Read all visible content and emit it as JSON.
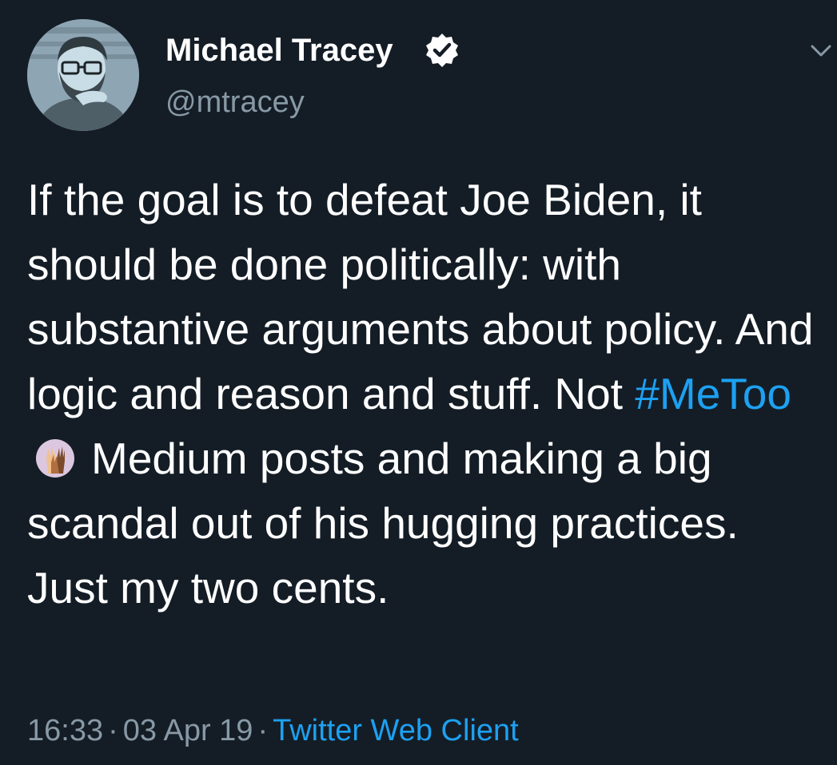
{
  "author": {
    "display_name": "Michael Tracey",
    "handle": "@mtracey",
    "verified_icon": "verified-badge-icon",
    "avatar": "profile-avatar"
  },
  "menu": {
    "icon": "chevron-down-icon"
  },
  "tweet": {
    "text_before": "If the goal is to defeat Joe Biden, it should be done politically: with substantive arguments about policy. And logic and reason and stuff. Not",
    "hashtag": "#MeToo",
    "emoji": "raised-hands-emoji",
    "text_after": "Medium posts and making a big scandal out of his hugging practices. Just my two cents."
  },
  "meta": {
    "time": "16:33",
    "separator": "·",
    "date": "03 Apr 19",
    "source": "Twitter Web Client"
  },
  "colors": {
    "background": "#141d26",
    "text": "#ffffff",
    "secondary": "#8899a6",
    "link": "#1da1f2"
  }
}
